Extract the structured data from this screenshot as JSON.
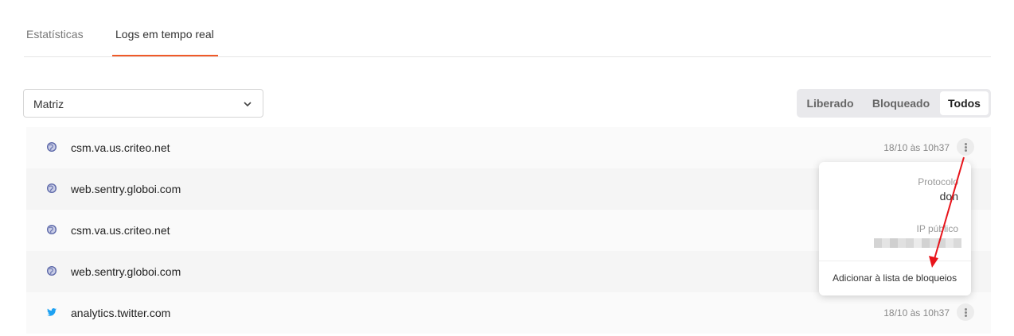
{
  "tabs": [
    {
      "label": "Estatísticas",
      "active": false
    },
    {
      "label": "Logs em tempo real",
      "active": true
    }
  ],
  "accent_color": "#f05a28",
  "filter_select": {
    "value": "Matriz"
  },
  "status_filter": {
    "options": [
      "Liberado",
      "Bloqueado",
      "Todos"
    ],
    "selected": "Todos"
  },
  "logs": [
    {
      "icon": "globe-icon",
      "domain": "csm.va.us.criteo.net",
      "time": "18/10 às 10h37"
    },
    {
      "icon": "globe-icon",
      "domain": "web.sentry.globoi.com",
      "time": ""
    },
    {
      "icon": "globe-icon",
      "domain": "csm.va.us.criteo.net",
      "time": ""
    },
    {
      "icon": "globe-icon",
      "domain": "web.sentry.globoi.com",
      "time": ""
    },
    {
      "icon": "twitter-icon",
      "domain": "analytics.twitter.com",
      "time": "18/10 às 10h37"
    }
  ],
  "popup": {
    "protocol_label": "Protocolo",
    "protocol_value": "doh",
    "ip_label": "IP público",
    "action_label": "Adicionar à lista de bloqueios"
  },
  "annotation_color": "#e8141b"
}
